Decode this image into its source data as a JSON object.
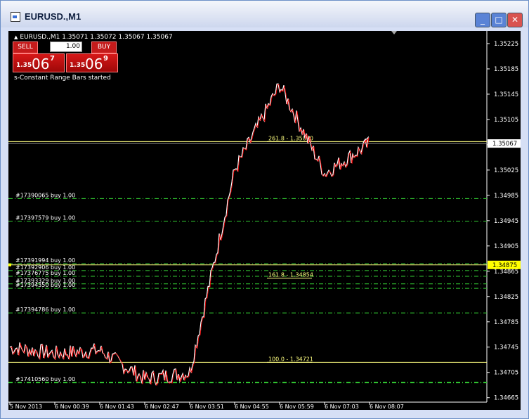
{
  "window": {
    "title": "EURUSD.,M1",
    "buttons": {
      "minimize": "_",
      "maximize": "□",
      "close": "✕"
    }
  },
  "toolbar": {
    "symbol_line": "EURUSD.,M1  1.35071 1.35072 1.35067 1.35067",
    "sell_label": "SELL",
    "buy_label": "BUY",
    "lot_value": "1.00",
    "sell_price": {
      "big": "1.35",
      "pips": "06",
      "frac": "7"
    },
    "buy_price": {
      "big": "1.35",
      "pips": "06",
      "frac": "9"
    }
  },
  "status_text": "s-Constant Range Bars started",
  "colors": {
    "background": "#000000",
    "bull_candle": "#ffffff",
    "bear_candle": "#ff0000",
    "fib_line": "#ffff80",
    "order_line": "#33cc33",
    "current_price_tag": "#ffffff",
    "highlight_price_tag": "#ffff00"
  },
  "chart_data": {
    "type": "line",
    "series": [
      {
        "x": [
          "5 Nov 2013",
          "6 Nov 00:39",
          "6 Nov 01:43",
          "6 Nov 02:47",
          "6 Nov 03:51",
          "6 Nov 04:55",
          "6 Nov 05:59",
          "6 Nov 07:03",
          "6 Nov 08:07"
        ],
        "values": [
          1.34745,
          1.34735,
          1.3474,
          1.34695,
          1.34705,
          1.35025,
          1.3516,
          1.3502,
          1.35067
        ]
      }
    ],
    "y_axis_ticks": [
      "1.35225",
      "1.35185",
      "1.35145",
      "1.35105",
      "1.35065",
      "1.35025",
      "1.34985",
      "1.34945",
      "1.34905",
      "1.34865",
      "1.34825",
      "1.34785",
      "1.34745",
      "1.34705",
      "1.34665"
    ],
    "x_axis_ticks": [
      "5 Nov 2013",
      "6 Nov 00:39",
      "6 Nov 01:43",
      "6 Nov 02:47",
      "6 Nov 03:51",
      "6 Nov 04:55",
      "6 Nov 05:59",
      "6 Nov 07:03",
      "6 Nov 08:07"
    ],
    "ylim": [
      1.34658,
      1.35245
    ],
    "current_price": "1.35067",
    "highlight_price": "1.34875",
    "fib_levels": [
      {
        "label": "261.8 - 1.35070",
        "price": 1.3507
      },
      {
        "label": "161.8 - 1.34854",
        "price": 1.34854
      },
      {
        "label": "100.0 - 1.34721",
        "price": 1.34721
      }
    ],
    "fib_solid_lines": [
      1.3507,
      1.34875,
      1.34721
    ],
    "orders": [
      {
        "label": "#17390065 buy 1.00",
        "price": 1.3498
      },
      {
        "label": "#17397579 buy 1.00",
        "price": 1.34944
      },
      {
        "label": "#17391994 buy 1.00",
        "price": 1.34877
      },
      {
        "label": "#17392906 buy 1.00",
        "price": 1.34866
      },
      {
        "label": "#17376775 buy 1.00",
        "price": 1.34857
      },
      {
        "label": "#17393329 buy 1.00",
        "price": 1.34845
      },
      {
        "label": "#17394350 buy 1.00",
        "price": 1.34838
      },
      {
        "label": "#17394786 buy 1.00",
        "price": 1.34799
      },
      {
        "label": "#17410560 buy 1.00",
        "price": 1.34689
      }
    ],
    "grid": false,
    "legend": "none"
  }
}
